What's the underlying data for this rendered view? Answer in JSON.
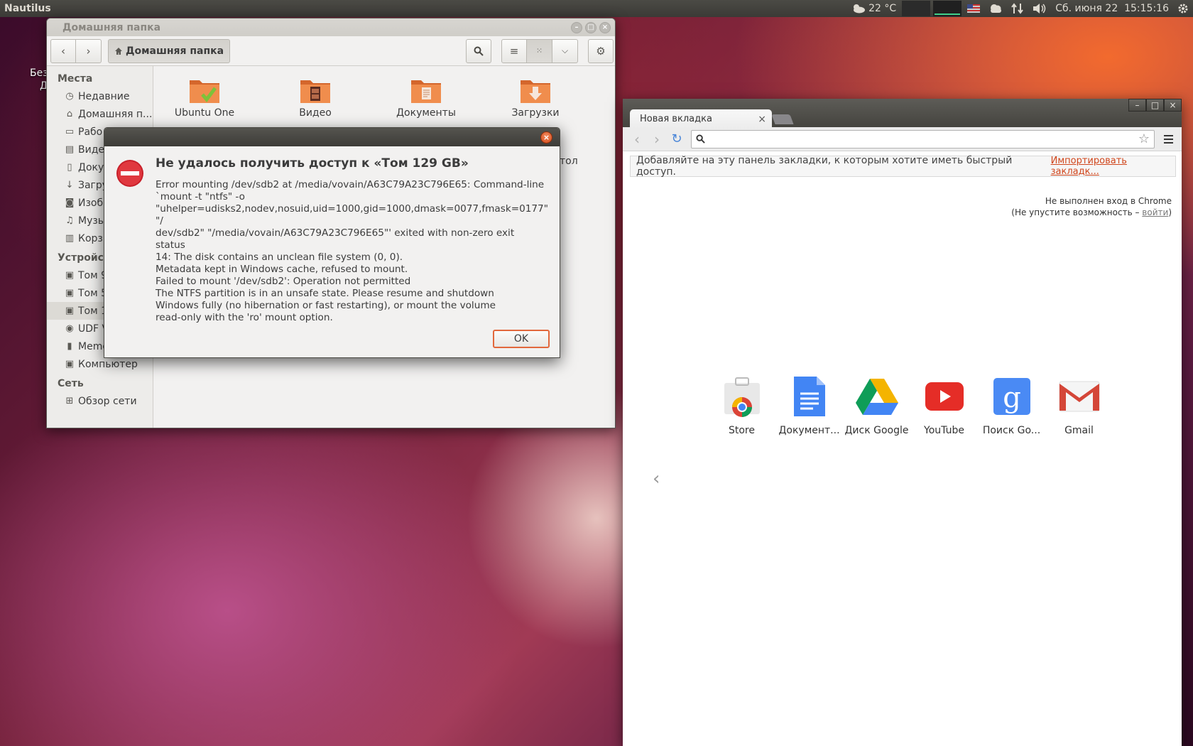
{
  "top_panel": {
    "app_name": "Nautilus",
    "weather": "22 °C",
    "datetime": "Сб. июня 22  15:15:16"
  },
  "desktop": {
    "icon_label_line1": "Без",
    "icon_label_line2": "Д"
  },
  "nautilus": {
    "title": "Домашняя папка",
    "path_button": "Домашняя папка",
    "sidebar": {
      "places_header": "Места",
      "places": [
        {
          "label": "Недавние",
          "icon": "clock-icon"
        },
        {
          "label": "Домашняя п...",
          "icon": "home-icon"
        },
        {
          "label": "Рабо",
          "icon": "desktop-icon"
        },
        {
          "label": "Виде",
          "icon": "film-icon"
        },
        {
          "label": "Доку",
          "icon": "document-icon"
        },
        {
          "label": "Загру",
          "icon": "download-icon"
        },
        {
          "label": "Изоб",
          "icon": "camera-icon"
        },
        {
          "label": "Музы",
          "icon": "music-icon"
        },
        {
          "label": "Корзи",
          "icon": "trash-icon"
        }
      ],
      "devices_header": "Устройст",
      "devices": [
        {
          "label": "Том 9",
          "icon": "drive-icon"
        },
        {
          "label": "Том 5",
          "icon": "drive-icon"
        },
        {
          "label": "Том 1",
          "icon": "drive-icon"
        },
        {
          "label": "UDF V",
          "icon": "disc-icon"
        },
        {
          "label": "Memo",
          "icon": "usb-icon"
        },
        {
          "label": "Компьютер",
          "icon": "drive-icon"
        }
      ],
      "network_header": "Сеть",
      "network": [
        {
          "label": "Обзор сети",
          "icon": "network-icon"
        }
      ]
    },
    "folders": [
      {
        "label": "Ubuntu One"
      },
      {
        "label": "Видео"
      },
      {
        "label": "Документы"
      },
      {
        "label": "Загрузки"
      }
    ],
    "partial_label": "тол"
  },
  "dialog": {
    "title": "Не удалось получить доступ к «Том 129 GB»",
    "message": "Error mounting /dev/sdb2 at /media/vovain/A63C79A23C796E65: Command-line\n`mount -t \"ntfs\" -o\n\"uhelper=udisks2,nodev,nosuid,uid=1000,gid=1000,dmask=0077,fmask=0177\" \"/\ndev/sdb2\" \"/media/vovain/A63C79A23C796E65\"' exited with non-zero exit status\n14: The disk contains an unclean file system (0, 0).\nMetadata kept in Windows cache, refused to mount.\nFailed to mount '/dev/sdb2': Operation not permitted\nThe NTFS partition is in an unsafe state. Please resume and shutdown\nWindows fully (no hibernation or fast restarting), or mount the volume\nread-only with the 'ro' mount option.",
    "ok_label": "OK"
  },
  "chrome": {
    "tab_title": "Новая вкладка",
    "omnibox_value": "",
    "bookmarks_text": "Добавляйте на эту панель закладки, к которым хотите иметь быстрый доступ.",
    "bookmarks_import": "Импортировать закладк...",
    "signin_line1": "Не выполнен вход в Chrome",
    "signin_line2_prefix": "(Не упустите возможность – ",
    "signin_link": "войти",
    "signin_line2_suffix": ")",
    "apps": [
      {
        "label": "Store",
        "icon": "chrome-store-icon"
      },
      {
        "label": "Документ...",
        "icon": "google-docs-icon"
      },
      {
        "label": "Диск Google",
        "icon": "google-drive-icon"
      },
      {
        "label": "YouTube",
        "icon": "youtube-icon"
      },
      {
        "label": "Поиск Go...",
        "icon": "google-search-icon"
      },
      {
        "label": "Gmail",
        "icon": "gmail-icon"
      }
    ]
  }
}
